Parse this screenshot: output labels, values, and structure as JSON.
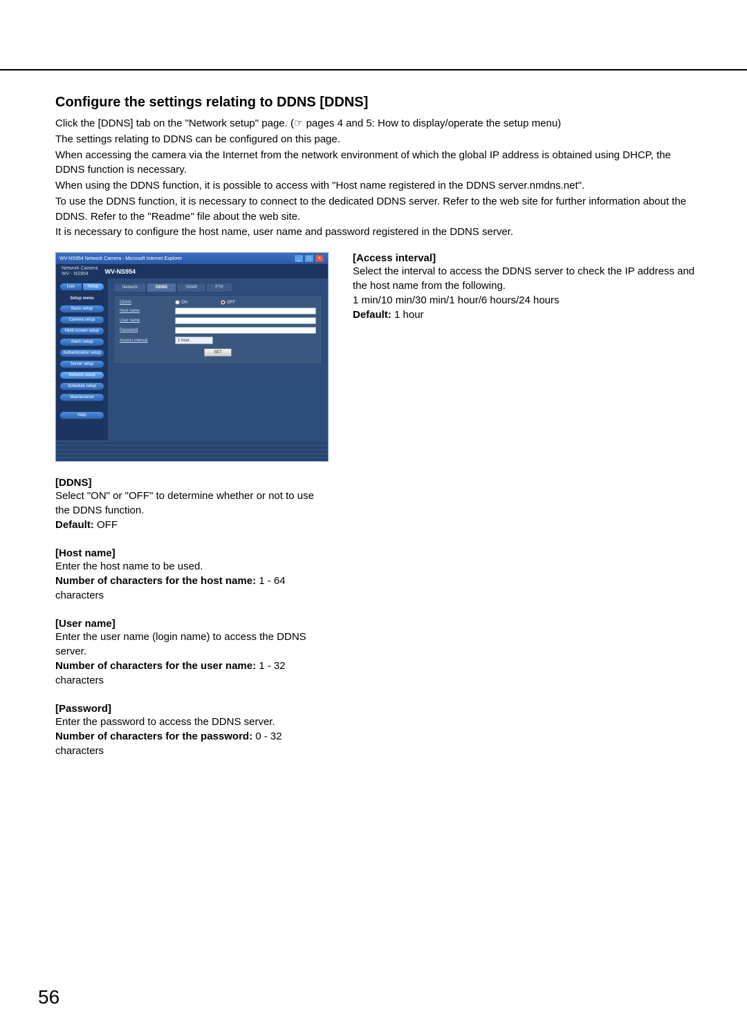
{
  "title": "Configure the settings relating to DDNS [DDNS]",
  "intro": [
    "Click the [DDNS] tab on the \"Network setup\" page. (☞ pages 4 and 5: How to display/operate the setup menu)",
    "The settings relating to DDNS can be configured on this page.",
    "When accessing the camera via the Internet from the network environment of which the global IP address is obtained using DHCP, the DDNS function is necessary.",
    "When using the DDNS function, it is possible to access with \"Host name registered in the DDNS server.nmdns.net\".",
    "To use the DDNS function, it is necessary to connect to the dedicated DDNS server. Refer to the web site for further information about the DDNS. Refer to the \"Readme\" file about the web site.",
    "It is necessary to configure the host name, user name and password registered in the DDNS server."
  ],
  "screenshot": {
    "window_title": "WV-NS954 Network Camera - Microsoft Internet Explorer",
    "brand_line1": "Network Camera",
    "brand_line2": "WV - NS954",
    "model": "WV-NS954",
    "top_tabs": {
      "live": "Live",
      "setup": "Setup"
    },
    "side_heading": "Setup menu",
    "side_items": [
      "Basic setup",
      "Camera setup",
      "Multi-screen setup",
      "Alarm setup",
      "Authentication setup",
      "Server setup",
      "Network setup",
      "Schedule setup",
      "Maintenance"
    ],
    "side_help": "Help",
    "tabs": [
      "Network",
      "DDNS",
      "SNMP",
      "FTP"
    ],
    "active_tab": "DDNS",
    "rows": {
      "ddns": "DDNS",
      "on": "ON",
      "off": "OFF",
      "host": "Host name",
      "user": "User name",
      "password": "Password",
      "interval": "Access interval",
      "interval_value": "1 hour"
    },
    "set_button": "SET"
  },
  "left_sections": [
    {
      "heading": "[DDNS]",
      "body": "Select \"ON\" or \"OFF\" to determine whether or not to use the DDNS function.",
      "default_label": "Default:",
      "default_value": " OFF"
    },
    {
      "heading": "[Host name]",
      "body": "Enter the host name to be used.",
      "num_label": "Number of characters for the host name:",
      "num_value": " 1 - 64 characters"
    },
    {
      "heading": "[User name]",
      "body": "Enter the user name (login name) to access the DDNS server.",
      "num_label": "Number of characters for the user name:",
      "num_value": " 1 - 32 characters"
    },
    {
      "heading": "[Password]",
      "body": "Enter the password to access the DDNS server.",
      "num_label": "Number of characters for the password:",
      "num_value": " 0 - 32 characters"
    }
  ],
  "right_section": {
    "heading": "[Access interval]",
    "body1": "Select the interval to access the DDNS server to check the IP address and the host name from the following.",
    "body2": "1 min/10 min/30 min/1 hour/6 hours/24 hours",
    "default_label": "Default:",
    "default_value": " 1 hour"
  },
  "page_number": "56"
}
